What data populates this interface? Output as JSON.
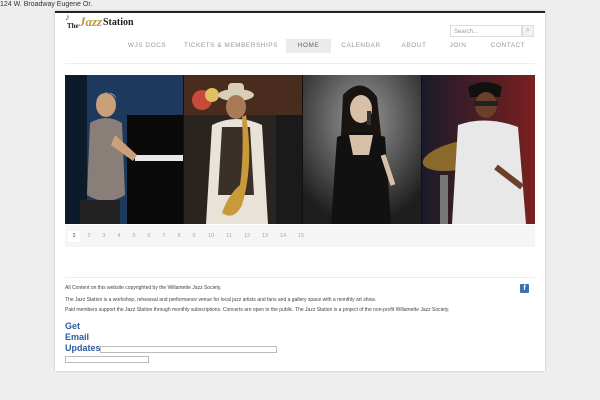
{
  "address": "124 W. Broadway Eugene Or.",
  "logo": {
    "the": "The",
    "jazz": "Jazz",
    "station": "Station"
  },
  "search": {
    "placeholder": "Search..."
  },
  "nav": {
    "items": [
      "WJS DOCS",
      "TICKETS & MEMBERSHIPS",
      "HOME",
      "CALENDAR",
      "ABOUT",
      "JOIN",
      "CONTACT"
    ],
    "active": "HOME"
  },
  "slider": {
    "photos": [
      "pianist-photo",
      "saxophonist-photo",
      "singer-photo",
      "drummer-photo"
    ],
    "pages": [
      "1",
      "2",
      "3",
      "4",
      "5",
      "6",
      "7",
      "8",
      "9",
      "10",
      "11",
      "12",
      "13",
      "14",
      "15"
    ],
    "active_page": "1"
  },
  "footer": {
    "line1": "All Content on this website copyrighted by the Willamette Jazz Society.",
    "line2": "The Jazz Station is a workshop, rehearsal and performance venue for local jazz artists and fans and a gallery space with a monthly art show.",
    "line3": "Paid members support the Jazz Station through monthly subscriptions. Concerts are open to the public. The Jazz Station is a project of the non-profit Willamette Jazz Society."
  },
  "email_updates": {
    "line1": "Get",
    "line2": "Email",
    "line3": "Updates"
  },
  "colors": {
    "accent": "#2c5c9a",
    "logo_gold": "#b89a3a",
    "facebook": "#3b6fb6"
  }
}
